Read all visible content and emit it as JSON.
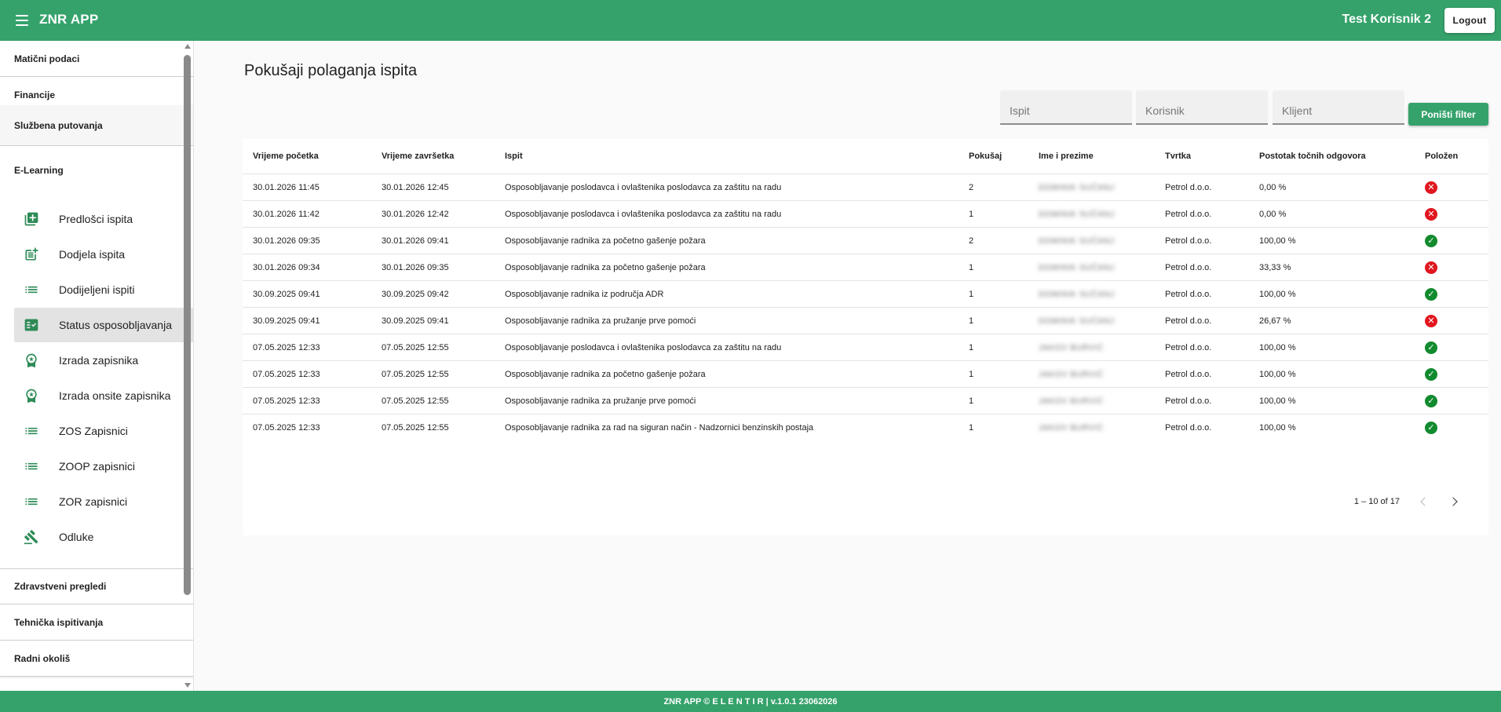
{
  "header": {
    "app_title": "ZNR APP",
    "user_name": "Test Korisnik 2",
    "logout_label": "Logout",
    "menu_icon": "menu-icon"
  },
  "sidebar": {
    "sections": [
      {
        "label": "Matični podaci",
        "expanded": false
      },
      {
        "label": "Financije",
        "expanded": false
      },
      {
        "label": "Službena putovanja",
        "expanded": false
      },
      {
        "label": "E-Learning",
        "expanded": true
      },
      {
        "label": "Zdravstveni pregledi",
        "expanded": false
      },
      {
        "label": "Tehnička ispitivanja",
        "expanded": false
      },
      {
        "label": "Radni okoliš",
        "expanded": false
      }
    ],
    "items": [
      {
        "label": "Predlošci ispita",
        "icon": "library-books-icon"
      },
      {
        "label": "Dodjela ispita",
        "icon": "post-add-icon"
      },
      {
        "label": "Dodijeljeni ispiti",
        "icon": "list-icon"
      },
      {
        "label": "Status osposobljavanja",
        "icon": "fact-check-icon",
        "active": true
      },
      {
        "label": "Izrada zapisnika",
        "icon": "workspace-premium-icon"
      },
      {
        "label": "Izrada onsite zapisnika",
        "icon": "workspace-premium-icon"
      },
      {
        "label": "ZOS Zapisnici",
        "icon": "list-icon"
      },
      {
        "label": "ZOOP zapisnici",
        "icon": "list-icon"
      },
      {
        "label": "ZOR zapisnici",
        "icon": "list-icon"
      },
      {
        "label": "Odluke",
        "icon": "gavel-icon"
      }
    ]
  },
  "main": {
    "title": "Pokušaji polaganja ispita",
    "filters": {
      "exam_placeholder": "Ispit",
      "user_placeholder": "Korisnik",
      "client_placeholder": "Klijent",
      "reset_label": "Poništi filter"
    },
    "table": {
      "columns": [
        "Vrijeme početka",
        "Vrijeme završetka",
        "Ispit",
        "Pokušaj",
        "Ime i prezime",
        "Tvrtka",
        "Postotak točnih odgovora",
        "Položen"
      ],
      "rows": [
        [
          "30.01.2026 11:45",
          "30.01.2026 12:45",
          "Osposobljavanje poslodavca i ovlaštenika poslodavca za zaštitu na radu",
          "2",
          "DOMINIK SUČANJ",
          "Petrol d.o.o.",
          "0,00 %",
          "fail"
        ],
        [
          "30.01.2026 11:42",
          "30.01.2026 12:42",
          "Osposobljavanje poslodavca i ovlaštenika poslodavca za zaštitu na radu",
          "1",
          "DOMINIK SUČANJ",
          "Petrol d.o.o.",
          "0,00 %",
          "fail"
        ],
        [
          "30.01.2026 09:35",
          "30.01.2026 09:41",
          "Osposobljavanje radnika za početno gašenje požara",
          "2",
          "DOMINIK SUČANJ",
          "Petrol d.o.o.",
          "100,00 %",
          "ok"
        ],
        [
          "30.01.2026 09:34",
          "30.01.2026 09:35",
          "Osposobljavanje radnika za početno gašenje požara",
          "1",
          "DOMINIK SUČANJ",
          "Petrol d.o.o.",
          "33,33 %",
          "fail"
        ],
        [
          "30.09.2025 09:41",
          "30.09.2025 09:42",
          "Osposobljavanje radnika iz područja ADR",
          "1",
          "DOMINIK SUČANJ",
          "Petrol d.o.o.",
          "100,00 %",
          "ok"
        ],
        [
          "30.09.2025 09:41",
          "30.09.2025 09:41",
          "Osposobljavanje radnika za pružanje prve pomoći",
          "1",
          "DOMINIK SUČANJ",
          "Petrol d.o.o.",
          "26,67 %",
          "fail"
        ],
        [
          "07.05.2025 12:33",
          "07.05.2025 12:55",
          "Osposobljavanje poslodavca i ovlaštenika poslodavca za zaštitu na radu",
          "1",
          "JAKOV BURVIĆ",
          "Petrol d.o.o.",
          "100,00 %",
          "ok"
        ],
        [
          "07.05.2025 12:33",
          "07.05.2025 12:55",
          "Osposobljavanje radnika za početno gašenje požara",
          "1",
          "JAKOV BURVIĆ",
          "Petrol d.o.o.",
          "100,00 %",
          "ok"
        ],
        [
          "07.05.2025 12:33",
          "07.05.2025 12:55",
          "Osposobljavanje radnika za pružanje prve pomoći",
          "1",
          "JAKOV BURVIĆ",
          "Petrol d.o.o.",
          "100,00 %",
          "ok"
        ],
        [
          "07.05.2025 12:33",
          "07.05.2025 12:55",
          "Osposobljavanje radnika za rad na siguran način - Nadzornici benzinskih postaja",
          "1",
          "JAKOV BURVIĆ",
          "Petrol d.o.o.",
          "100,00 %",
          "ok"
        ]
      ]
    },
    "pagination": {
      "range_label": "1 – 10 of 17"
    }
  },
  "footer": {
    "text": "ZNR APP © E L E N T I R | v.1.0.1 23062026"
  },
  "colors": {
    "brand_green": "#35a26b",
    "icon_green": "#2e8b57",
    "ok_green": "#128a2e",
    "fail_red": "#e1161f"
  }
}
